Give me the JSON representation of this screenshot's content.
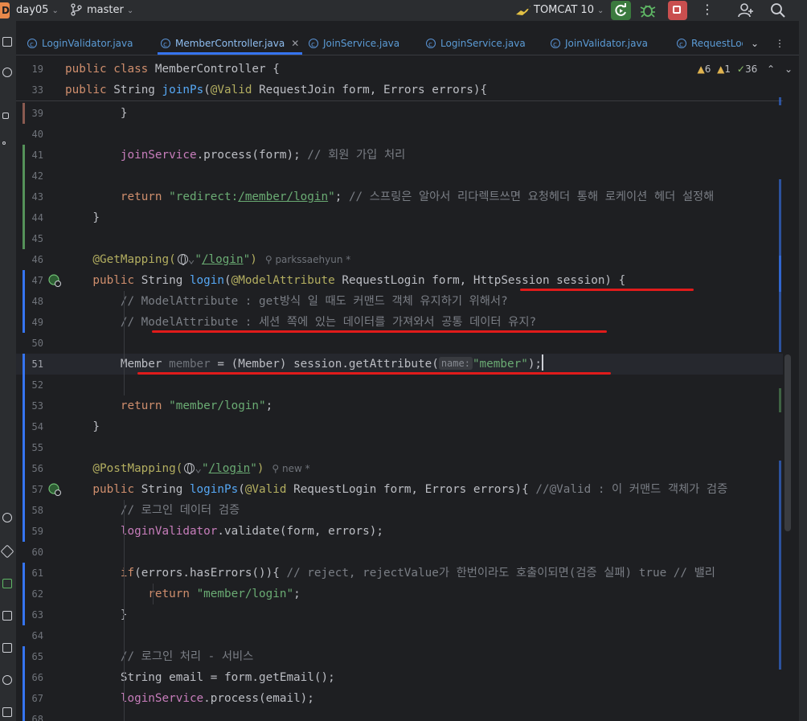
{
  "titlebar": {
    "project_badge": "D",
    "project_name": "day05",
    "branch": "master",
    "run_config": "TOMCAT 10"
  },
  "tabs": [
    {
      "label": "LoginValidator.java"
    },
    {
      "label": "MemberController.java",
      "active": true
    },
    {
      "label": "JoinService.java"
    },
    {
      "label": "LoginService.java"
    },
    {
      "label": "JoinValidator.java"
    },
    {
      "label": "RequestLog"
    }
  ],
  "inspections": {
    "warnings": "6",
    "weak_warnings": "1",
    "ok": "36"
  },
  "sticky": [
    {
      "num": "19",
      "parts": [
        [
          "kw",
          "public class "
        ],
        [
          "",
          "MemberController {"
        ]
      ]
    },
    {
      "num": "33",
      "parts": [
        [
          "kw",
          "public "
        ],
        [
          "",
          "String "
        ],
        [
          "me",
          "joinPs"
        ],
        [
          "",
          "("
        ],
        [
          "an",
          "@Valid "
        ],
        [
          "",
          "RequestJoin form, Errors errors){"
        ]
      ]
    }
  ],
  "lines": [
    {
      "num": "39",
      "parts": [
        [
          "",
          "        }"
        ]
      ]
    },
    {
      "num": "40",
      "parts": []
    },
    {
      "num": "41",
      "parts": [
        [
          "",
          "        "
        ],
        [
          "fi",
          "joinService"
        ],
        [
          "",
          ".process(form); "
        ],
        [
          "cm",
          "// 회원 가입 처리"
        ]
      ]
    },
    {
      "num": "42",
      "parts": []
    },
    {
      "num": "43",
      "parts": [
        [
          "",
          "        "
        ],
        [
          "kw",
          "return "
        ],
        [
          "st",
          "\"redirect:"
        ],
        [
          "st link",
          "/member/login"
        ],
        [
          "st",
          "\""
        ],
        [
          "",
          "; "
        ],
        [
          "cm",
          "// 스프링은 알아서 리다렉트쓰면 요청헤더 통해 로케이션 헤더 설정해"
        ]
      ]
    },
    {
      "num": "44",
      "parts": [
        [
          "",
          "    }"
        ]
      ]
    },
    {
      "num": "45",
      "parts": []
    },
    {
      "num": "46",
      "parts": [
        [
          "an",
          "    @GetMapping("
        ],
        [
          "globe",
          ""
        ],
        [
          "un",
          "⌄"
        ],
        [
          "st",
          "\""
        ],
        [
          "st link",
          "/login"
        ],
        [
          "st",
          "\""
        ],
        [
          "an",
          ")"
        ]
      ],
      "author": "parkssaehyun *"
    },
    {
      "num": "47",
      "parts": [
        [
          "kw",
          "    public "
        ],
        [
          "",
          "String "
        ],
        [
          "me",
          "login"
        ],
        [
          "",
          "("
        ],
        [
          "an",
          "@ModelAttribute "
        ],
        [
          "",
          "RequestLogin form, HttpSession session) {"
        ]
      ]
    },
    {
      "num": "48",
      "parts": [
        [
          "cm",
          "        // ModelAttribute : get방식 일 때도 커맨드 객체 유지하기 위해서?"
        ]
      ]
    },
    {
      "num": "49",
      "parts": [
        [
          "cm",
          "        // ModelAttribute : 세션 쪽에 있는 데이터를 가져와서 공통 데이터 유지?"
        ]
      ]
    },
    {
      "num": "50",
      "parts": []
    },
    {
      "num": "51",
      "parts": [
        [
          "",
          "        Member "
        ],
        [
          "un",
          "member"
        ],
        [
          "",
          " = (Member) session.getAttribute("
        ],
        [
          "hint",
          "name:"
        ],
        [
          "st",
          "\"member\""
        ],
        [
          "",
          ");"
        ],
        [
          "caret",
          ""
        ]
      ],
      "current": true
    },
    {
      "num": "52",
      "parts": []
    },
    {
      "num": "53",
      "parts": [
        [
          "",
          "        "
        ],
        [
          "kw",
          "return "
        ],
        [
          "st",
          "\"member/login\""
        ],
        [
          "",
          ";"
        ]
      ]
    },
    {
      "num": "54",
      "parts": [
        [
          "",
          "    }"
        ]
      ]
    },
    {
      "num": "55",
      "parts": []
    },
    {
      "num": "56",
      "parts": [
        [
          "an",
          "    @PostMapping("
        ],
        [
          "globe",
          ""
        ],
        [
          "un",
          "⌄"
        ],
        [
          "st",
          "\""
        ],
        [
          "st link",
          "/login"
        ],
        [
          "st",
          "\""
        ],
        [
          "an",
          ")"
        ]
      ],
      "author": "new *"
    },
    {
      "num": "57",
      "parts": [
        [
          "kw",
          "    public "
        ],
        [
          "",
          "String "
        ],
        [
          "me",
          "loginPs"
        ],
        [
          "",
          "("
        ],
        [
          "an",
          "@Valid "
        ],
        [
          "",
          "RequestLogin form, Errors errors){ "
        ],
        [
          "cm",
          "//@Valid : 이 커맨드 객체가 검증"
        ]
      ]
    },
    {
      "num": "58",
      "parts": [
        [
          "cm",
          "        // 로그인 데이터 검증"
        ]
      ]
    },
    {
      "num": "59",
      "parts": [
        [
          "",
          "        "
        ],
        [
          "fi",
          "loginValidator"
        ],
        [
          "",
          ".validate(form, errors);"
        ]
      ]
    },
    {
      "num": "60",
      "parts": []
    },
    {
      "num": "61",
      "parts": [
        [
          "",
          "        "
        ],
        [
          "kw",
          "if"
        ],
        [
          "",
          "(errors.hasErrors()){ "
        ],
        [
          "cm",
          "// reject, rejectValue가 한번이라도 호출이되면(검증 실패) true // 밸리"
        ]
      ]
    },
    {
      "num": "62",
      "parts": [
        [
          "",
          "            "
        ],
        [
          "kw",
          "return "
        ],
        [
          "st",
          "\"member/login\""
        ],
        [
          "",
          ";"
        ]
      ]
    },
    {
      "num": "63",
      "parts": [
        [
          "",
          "        }"
        ]
      ]
    },
    {
      "num": "64",
      "parts": []
    },
    {
      "num": "65",
      "parts": [
        [
          "cm",
          "        // 로그인 처리 - 서비스"
        ]
      ]
    },
    {
      "num": "66",
      "parts": [
        [
          "",
          "        String email = form.getEmail();"
        ]
      ]
    },
    {
      "num": "67",
      "parts": [
        [
          "",
          "        "
        ],
        [
          "fi",
          "loginService"
        ],
        [
          "",
          ".process(email);"
        ]
      ]
    },
    {
      "num": "68",
      "parts": []
    }
  ],
  "colors": {
    "annotation_underline": "#e01b1b",
    "active_tab_accent": "#3574f0",
    "run_button": "#3b7a3e",
    "stop_button": "#c94f4f"
  }
}
